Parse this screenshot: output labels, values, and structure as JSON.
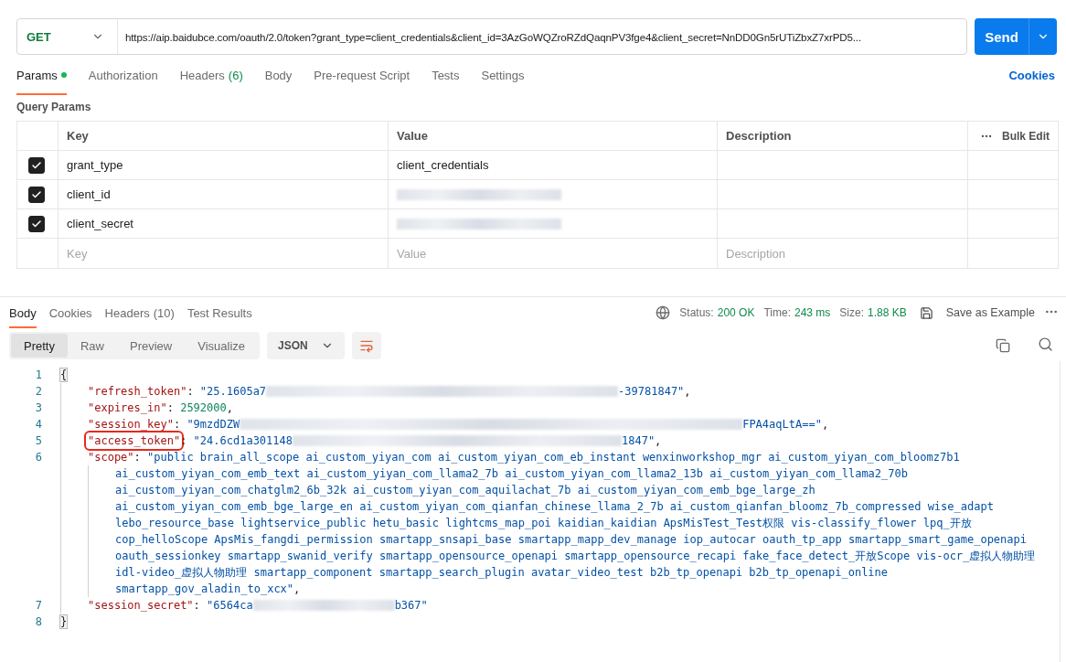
{
  "request": {
    "method": "GET",
    "url": "https://aip.baidubce.com/oauth/2.0/token?grant_type=client_credentials&client_id=3AzGoWQZroRZdQaqnPV3fge4&client_secret=NnDD0Gn5rUTiZbxZ7xrPD5...",
    "send": "Send"
  },
  "request_tabs": [
    {
      "label": "Params",
      "selected": true,
      "dot": true
    },
    {
      "label": "Authorization",
      "selected": false
    },
    {
      "label": "Headers",
      "count": "(6)",
      "selected": false
    },
    {
      "label": "Body",
      "selected": false
    },
    {
      "label": "Pre-request Script",
      "selected": false
    },
    {
      "label": "Tests",
      "selected": false
    },
    {
      "label": "Settings",
      "selected": false
    }
  ],
  "cookies_link": "Cookies",
  "params": {
    "title": "Query Params",
    "columns": [
      "Key",
      "Value",
      "Description"
    ],
    "bulk_edit": "Bulk Edit",
    "rows": [
      {
        "checked": true,
        "key": "grant_type",
        "value": [
          {
            "kind": "text",
            "text": "client_credentials"
          }
        ]
      },
      {
        "checked": true,
        "key": "client_id",
        "value": [
          {
            "kind": "redacted"
          }
        ]
      },
      {
        "checked": true,
        "key": "client_secret",
        "value": [
          {
            "kind": "redacted"
          }
        ]
      }
    ],
    "placeholders": {
      "key": "Key",
      "value": "Value",
      "description": "Description"
    }
  },
  "response_tabs": [
    {
      "label": "Body",
      "selected": true
    },
    {
      "label": "Cookies",
      "selected": false
    },
    {
      "label": "Headers",
      "count": "(10)",
      "selected": false
    },
    {
      "label": "Test Results",
      "selected": false
    }
  ],
  "status": [
    {
      "label": "Status:",
      "value": "200 OK"
    },
    {
      "label": "Time:",
      "value": "243 ms"
    },
    {
      "label": "Size:",
      "value": "1.88 KB"
    }
  ],
  "save_example": "Save as Example",
  "view_modes": [
    {
      "label": "Pretty",
      "selected": true
    },
    {
      "label": "Raw",
      "selected": false
    },
    {
      "label": "Preview",
      "selected": false
    },
    {
      "label": "Visualize",
      "selected": false
    }
  ],
  "format": "JSON",
  "code": [
    {
      "number": "1",
      "kind": "bracket",
      "tokens": [
        {
          "kind": "bracket",
          "text": "{"
        }
      ]
    },
    {
      "number": "2",
      "kind": "member",
      "tokens": [
        {
          "kind": "key",
          "text": "\"refresh_token\""
        },
        {
          "kind": "punct",
          "text": ": "
        },
        {
          "kind": "string",
          "text": "\"25.1605a7"
        },
        {
          "kind": "redacted"
        },
        {
          "kind": "string",
          "text": "-39781847\""
        },
        {
          "kind": "punct",
          "text": ","
        }
      ]
    },
    {
      "number": "3",
      "kind": "member",
      "tokens": [
        {
          "kind": "key",
          "text": "\"expires_in\""
        },
        {
          "kind": "punct",
          "text": ": "
        },
        {
          "kind": "number",
          "text": "2592000"
        },
        {
          "kind": "punct",
          "text": ","
        }
      ]
    },
    {
      "number": "4",
      "kind": "member",
      "tokens": [
        {
          "kind": "key",
          "text": "\"session_key\""
        },
        {
          "kind": "punct",
          "text": ": "
        },
        {
          "kind": "string",
          "text": "\"9mzdDZW"
        },
        {
          "kind": "redacted"
        },
        {
          "kind": "string",
          "text": "FPA4aqLtA==\""
        },
        {
          "kind": "punct",
          "text": ","
        }
      ]
    },
    {
      "number": "5",
      "kind": "member",
      "tokens": [
        {
          "kind": "key",
          "text": "\"access_token\"",
          "highlighted": true
        },
        {
          "kind": "punct",
          "text": ": "
        },
        {
          "kind": "string",
          "text": "\"24.6cd1a301148"
        },
        {
          "kind": "redacted"
        },
        {
          "kind": "string",
          "text": "1847\""
        },
        {
          "kind": "punct",
          "text": ","
        }
      ]
    },
    {
      "number": "6",
      "kind": "member",
      "tokens": [
        {
          "kind": "key",
          "text": "\"scope\""
        },
        {
          "kind": "punct",
          "text": ": "
        },
        {
          "kind": "string",
          "text": "\"public brain_all_scope ai_custom_yiyan_com ai_custom_yiyan_com_eb_instant wenxinworkshop_mgr ai_custom_yiyan_com_bloomz7b1"
        }
      ]
    },
    {
      "kind": "wrap",
      "tokens": [
        {
          "kind": "string",
          "text": "ai_custom_yiyan_com_emb_text ai_custom_yiyan_com_llama2_7b ai_custom_yiyan_com_llama2_13b ai_custom_yiyan_com_llama2_70b"
        }
      ]
    },
    {
      "kind": "wrap",
      "tokens": [
        {
          "kind": "string",
          "text": "ai_custom_yiyan_com_chatglm2_6b_32k ai_custom_yiyan_com_aquilachat_7b ai_custom_yiyan_com_emb_bge_large_zh"
        }
      ]
    },
    {
      "kind": "wrap",
      "tokens": [
        {
          "kind": "string",
          "text": "ai_custom_yiyan_com_emb_bge_large_en ai_custom_yiyan_com_qianfan_chinese_llama_2_7b ai_custom_qianfan_bloomz_7b_compressed wise_adapt"
        }
      ]
    },
    {
      "kind": "wrap",
      "tokens": [
        {
          "kind": "string",
          "text": "lebo_resource_base lightservice_public hetu_basic lightcms_map_poi kaidian_kaidian ApsMisTest_Test权限 vis-classify_flower lpq_开放"
        }
      ]
    },
    {
      "kind": "wrap",
      "tokens": [
        {
          "kind": "string",
          "text": "cop_helloScope ApsMis_fangdi_permission smartapp_snsapi_base smartapp_mapp_dev_manage iop_autocar oauth_tp_app smartapp_smart_game_openapi"
        }
      ]
    },
    {
      "kind": "wrap",
      "tokens": [
        {
          "kind": "string",
          "text": "oauth_sessionkey smartapp_swanid_verify smartapp_opensource_openapi smartapp_opensource_recapi fake_face_detect_开放Scope vis-ocr_虚拟人物助理"
        }
      ]
    },
    {
      "kind": "wrap",
      "tokens": [
        {
          "kind": "string",
          "text": "idl-video_虚拟人物助理 smartapp_component smartapp_search_plugin avatar_video_test b2b_tp_openapi b2b_tp_openapi_online"
        }
      ]
    },
    {
      "kind": "wrap",
      "tokens": [
        {
          "kind": "string",
          "text": "smartapp_gov_aladin_to_xcx\""
        },
        {
          "kind": "punct",
          "text": ","
        }
      ]
    },
    {
      "number": "7",
      "kind": "member",
      "tokens": [
        {
          "kind": "key",
          "text": "\"session_secret\""
        },
        {
          "kind": "punct",
          "text": ": "
        },
        {
          "kind": "string",
          "text": "\"6564ca"
        },
        {
          "kind": "redacted"
        },
        {
          "kind": "string",
          "text": "b367\""
        }
      ]
    },
    {
      "number": "8",
      "kind": "bracket",
      "tokens": [
        {
          "kind": "bracket",
          "text": "}"
        }
      ]
    }
  ]
}
